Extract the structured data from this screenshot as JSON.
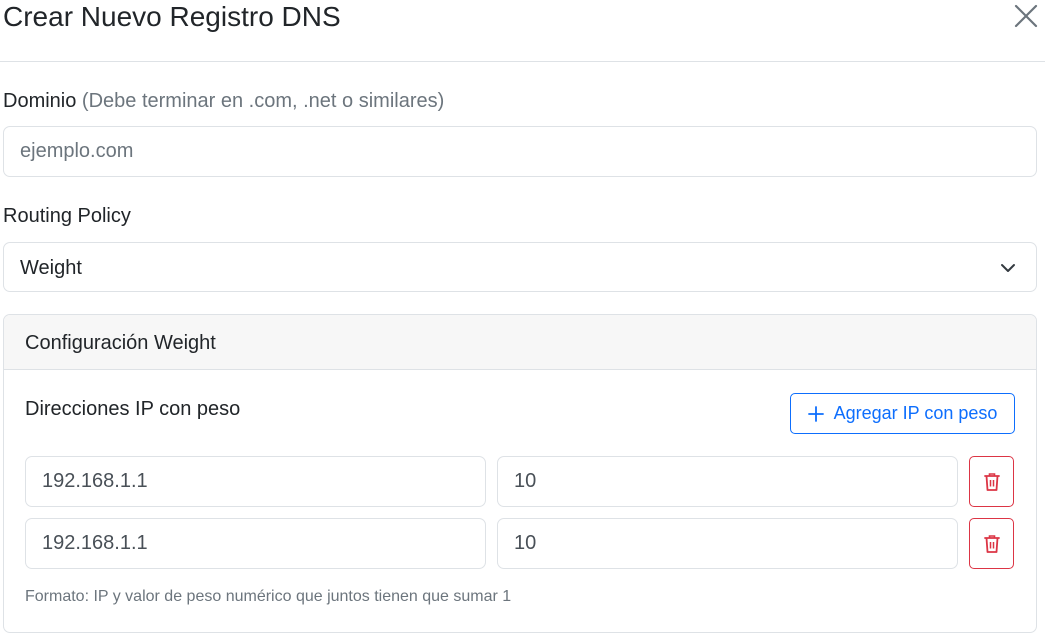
{
  "modal": {
    "title": "Crear Nuevo Registro DNS",
    "close_icon": "close-icon"
  },
  "domain": {
    "label": "Dominio",
    "hint": "(Debe terminar en .com, .net o similares)",
    "placeholder": "ejemplo.com",
    "value": ""
  },
  "routing": {
    "label": "Routing Policy",
    "selected": "Weight",
    "chevron_icon": "chevron-down-icon"
  },
  "weight_config": {
    "header": "Configuración Weight",
    "section_label": "Direcciones IP con peso",
    "add_button": "Agregar IP con peso",
    "add_icon": "plus-icon",
    "rows": [
      {
        "ip": "192.168.1.1",
        "weight": "10"
      },
      {
        "ip": "192.168.1.1",
        "weight": "10"
      }
    ],
    "delete_icon": "trash-icon",
    "help": "Formato: IP y valor de peso numérico que juntos tienen que sumar 1"
  },
  "colors": {
    "primary": "#0d6efd",
    "danger": "#dc3545",
    "border": "#dee2e6",
    "muted": "#6c757d",
    "header_bg": "#f7f7f7"
  }
}
